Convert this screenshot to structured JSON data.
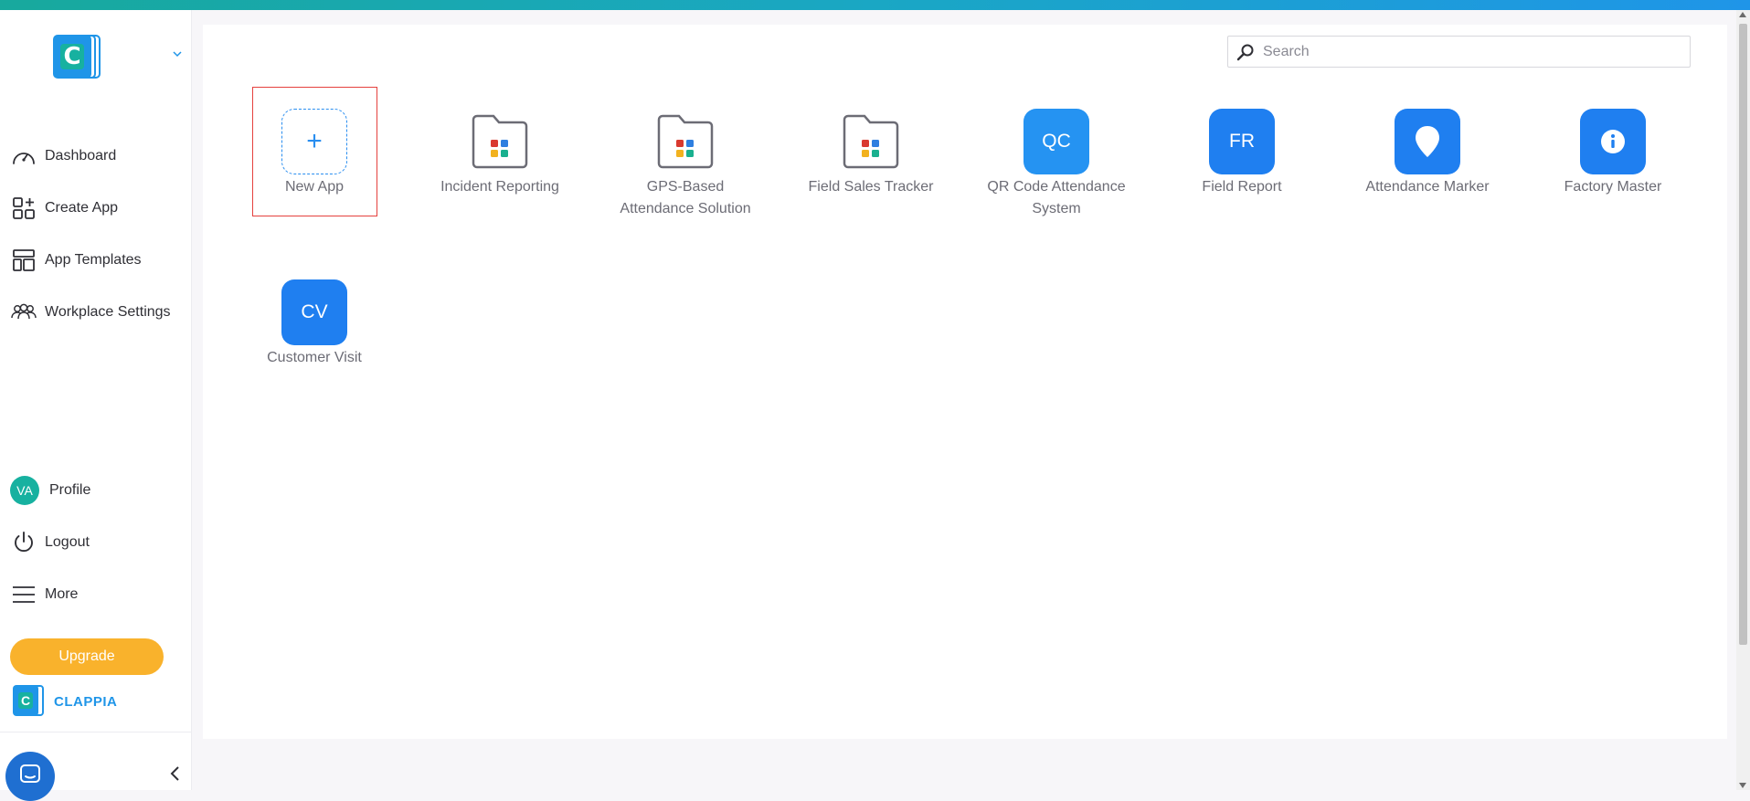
{
  "sidebar": {
    "nav": [
      {
        "label": "Dashboard",
        "icon": "gauge-icon"
      },
      {
        "label": "Create App",
        "icon": "create-app-icon"
      },
      {
        "label": "App Templates",
        "icon": "templates-icon"
      },
      {
        "label": "Workplace Settings",
        "icon": "people-icon"
      }
    ],
    "profile": {
      "initials": "VA",
      "label": "Profile"
    },
    "logout_label": "Logout",
    "more_label": "More",
    "upgrade_label": "Upgrade",
    "brand_name": "CLAPPIA",
    "brand_mark": "C"
  },
  "search": {
    "placeholder": "Search"
  },
  "apps": [
    {
      "id": "new-app",
      "name": "New App",
      "kind": "new",
      "glyph": "+"
    },
    {
      "id": "incident-reporting",
      "name": "Incident Reporting",
      "kind": "folder"
    },
    {
      "id": "gps-attendance",
      "name": "GPS-Based Attendance Solution",
      "kind": "folder"
    },
    {
      "id": "field-sales-tracker",
      "name": "Field Sales Tracker",
      "kind": "folder"
    },
    {
      "id": "qr-code-attendance",
      "name": "QR Code Attendance System",
      "kind": "initials",
      "initials": "QC"
    },
    {
      "id": "field-report",
      "name": "Field Report",
      "kind": "initials",
      "initials": "FR"
    },
    {
      "id": "attendance-marker",
      "name": "Attendance Marker",
      "kind": "icon",
      "icon": "location-pin-icon"
    },
    {
      "id": "factory-master",
      "name": "Factory Master",
      "kind": "icon",
      "icon": "info-icon"
    },
    {
      "id": "customer-visit",
      "name": "Customer Visit",
      "kind": "initials",
      "initials": "CV"
    }
  ],
  "colors": {
    "accent": "#1f7ff0",
    "teal": "#17b1a0",
    "upgrade": "#f9b22c",
    "selection": "#e5413e"
  }
}
